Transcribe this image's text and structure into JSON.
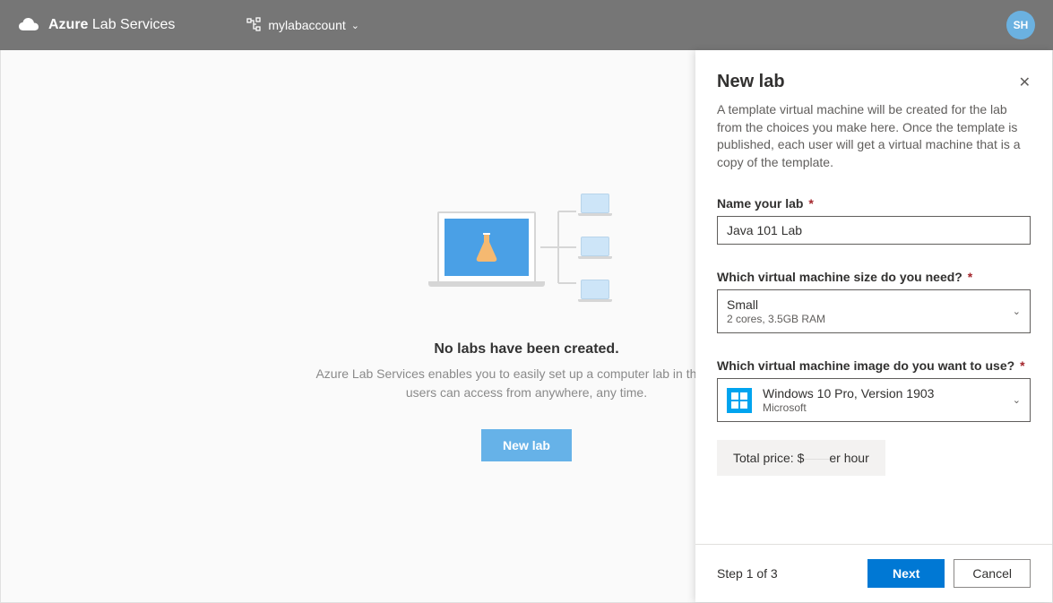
{
  "brand": {
    "bold": "Azure",
    "rest": " Lab Services"
  },
  "account_name": "mylabaccount",
  "user_initials": "SH",
  "empty": {
    "title": "No labs have been created.",
    "desc": "Azure Lab Services enables you to easily set up a computer lab in the cloud users can access from anywhere, any time.",
    "button": "New lab"
  },
  "panel": {
    "title": "New lab",
    "desc": "A template virtual machine will be created for the lab from the choices you make here. Once the template is published, each user will get a virtual machine that is a copy of the template.",
    "name_label": "Name your lab",
    "name_value": "Java 101 Lab",
    "size_label": "Which virtual machine size do you need?",
    "size_primary": "Small",
    "size_secondary": "2 cores, 3.5GB RAM",
    "image_label": "Which virtual machine image do you want to use?",
    "image_primary": "Windows 10 Pro, Version 1903",
    "image_secondary": "Microsoft",
    "price_label": "Total price: $",
    "price_suffix": "er hour",
    "step": "Step 1 of 3",
    "next": "Next",
    "cancel": "Cancel"
  }
}
